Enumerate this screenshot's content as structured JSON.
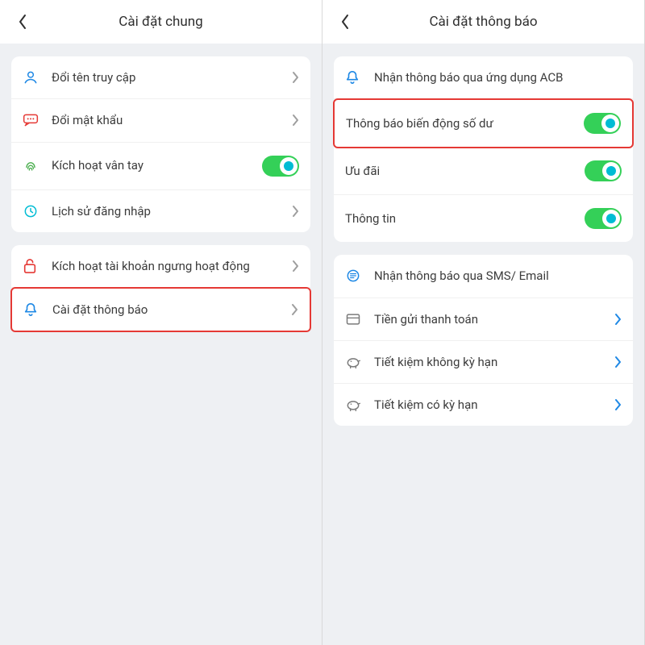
{
  "left": {
    "title": "Cài đặt chung",
    "group1": {
      "rename": {
        "label": "Đổi tên truy cập"
      },
      "password": {
        "label": "Đổi mật khẩu"
      },
      "fingerprint": {
        "label": "Kích hoạt vân tay",
        "on": true
      },
      "history": {
        "label": "Lịch sử đăng nhập"
      }
    },
    "group2": {
      "reactivate": {
        "label": "Kích hoạt tài khoản ngưng hoạt động"
      },
      "notif": {
        "label": "Cài đặt thông báo"
      }
    }
  },
  "right": {
    "title": "Cài đặt thông báo",
    "appSection": {
      "header": "Nhận thông báo qua ứng dụng ACB",
      "balance": {
        "label": "Thông báo biến động số dư",
        "on": true
      },
      "offers": {
        "label": "Ưu đãi",
        "on": true
      },
      "info": {
        "label": "Thông tin",
        "on": true
      }
    },
    "smsSection": {
      "header": "Nhận thông báo qua SMS/ Email",
      "deposit": {
        "label": "Tiền gửi thanh toán"
      },
      "savNoTerm": {
        "label": "Tiết kiệm không kỳ hạn"
      },
      "savTerm": {
        "label": "Tiết kiệm có kỳ hạn"
      }
    }
  }
}
